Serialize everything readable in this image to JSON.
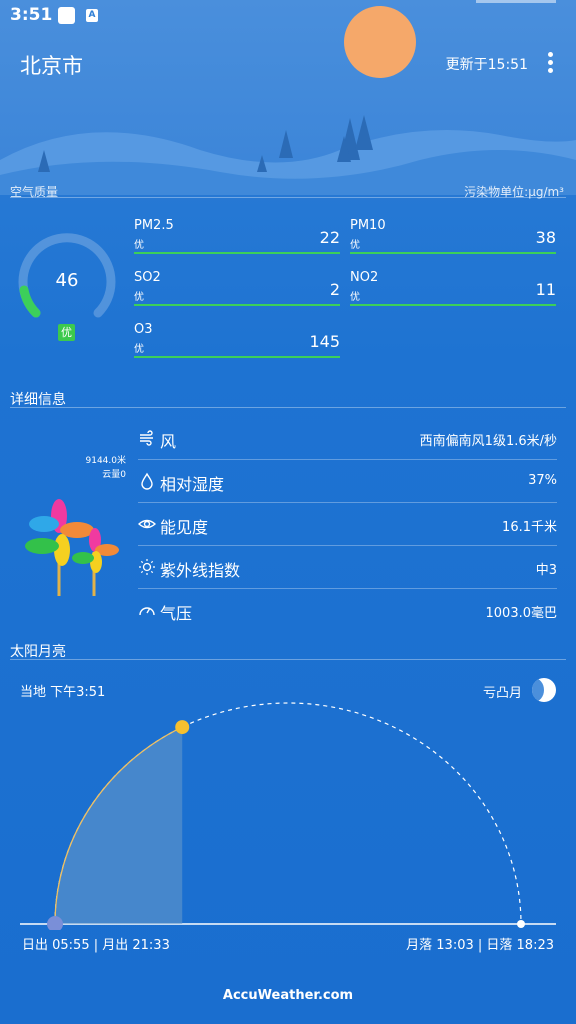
{
  "status_bar": {
    "time": "3:51",
    "notification_icon": "A"
  },
  "header": {
    "city": "北京市",
    "updated": "更新于15:51"
  },
  "air_quality": {
    "title": "空气质量",
    "unit_note": "污染物单位:μg/m³",
    "aqi": "46",
    "aqi_level": "优",
    "pollutants": [
      {
        "name": "PM2.5",
        "level": "优",
        "value": "22"
      },
      {
        "name": "PM10",
        "level": "优",
        "value": "38"
      },
      {
        "name": "SO2",
        "level": "优",
        "value": "2"
      },
      {
        "name": "NO2",
        "level": "优",
        "value": "11"
      },
      {
        "name": "O3",
        "level": "优",
        "value": "145"
      }
    ]
  },
  "details": {
    "title": "详细信息",
    "cloud_height": "9144.0米",
    "cloud_cover": "云量0",
    "rows": [
      {
        "label": "风",
        "value": "西南偏南风1级1.6米/秒",
        "icon": "wind-icon"
      },
      {
        "label": "相对湿度",
        "value": "37%",
        "icon": "humidity-icon"
      },
      {
        "label": "能见度",
        "value": "16.1千米",
        "icon": "eye-icon"
      },
      {
        "label": "紫外线指数",
        "value": "中3",
        "icon": "sun-icon"
      },
      {
        "label": "气压",
        "value": "1003.0毫巴",
        "icon": "gauge-icon"
      }
    ]
  },
  "sun_moon": {
    "title": "太阳月亮",
    "local_time": "当地 下午3:51",
    "moon_phase": "亏凸月",
    "rise": "日出 05:55 | 月出 21:33",
    "set": "月落 13:03 | 日落 18:23",
    "sun_progress": 0.35
  },
  "footer": {
    "brand": "AccuWeather.com"
  },
  "colors": {
    "good": "#3ccf5a",
    "sun": "#f5a86a",
    "background": "#1e73d2"
  }
}
